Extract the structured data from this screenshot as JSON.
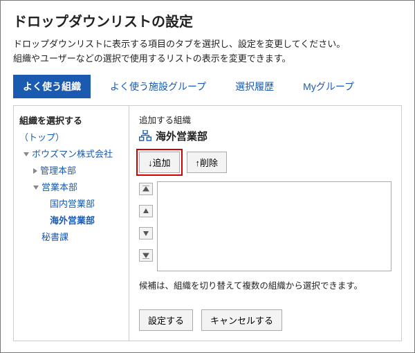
{
  "header": {
    "title": "ドロップダウンリストの設定",
    "desc_line1": "ドロップダウンリストに表示する項目のタブを選択し、設定を変更してください。",
    "desc_line2": "組織やユーザーなどの選択で使用するリストの表示を変更できます。"
  },
  "tabs": {
    "frequent_org": "よく使う組織",
    "frequent_facility": "よく使う施設グループ",
    "history": "選択履歴",
    "my_group": "Myグループ"
  },
  "sidebar": {
    "title": "組織を選択する",
    "top": "（トップ）",
    "company": "ボウズマン株式会社",
    "admin": "管理本部",
    "sales": "営業本部",
    "domestic": "国内営業部",
    "overseas": "海外営業部",
    "secretary": "秘書課"
  },
  "content": {
    "add_label": "追加する組織",
    "selected_org": "海外営業部",
    "add_button": "↓追加",
    "remove_button": "↑削除",
    "hint": "候補は、組織を切り替えて複数の組織から選択できます。",
    "submit": "設定する",
    "cancel": "キャンセルする"
  }
}
